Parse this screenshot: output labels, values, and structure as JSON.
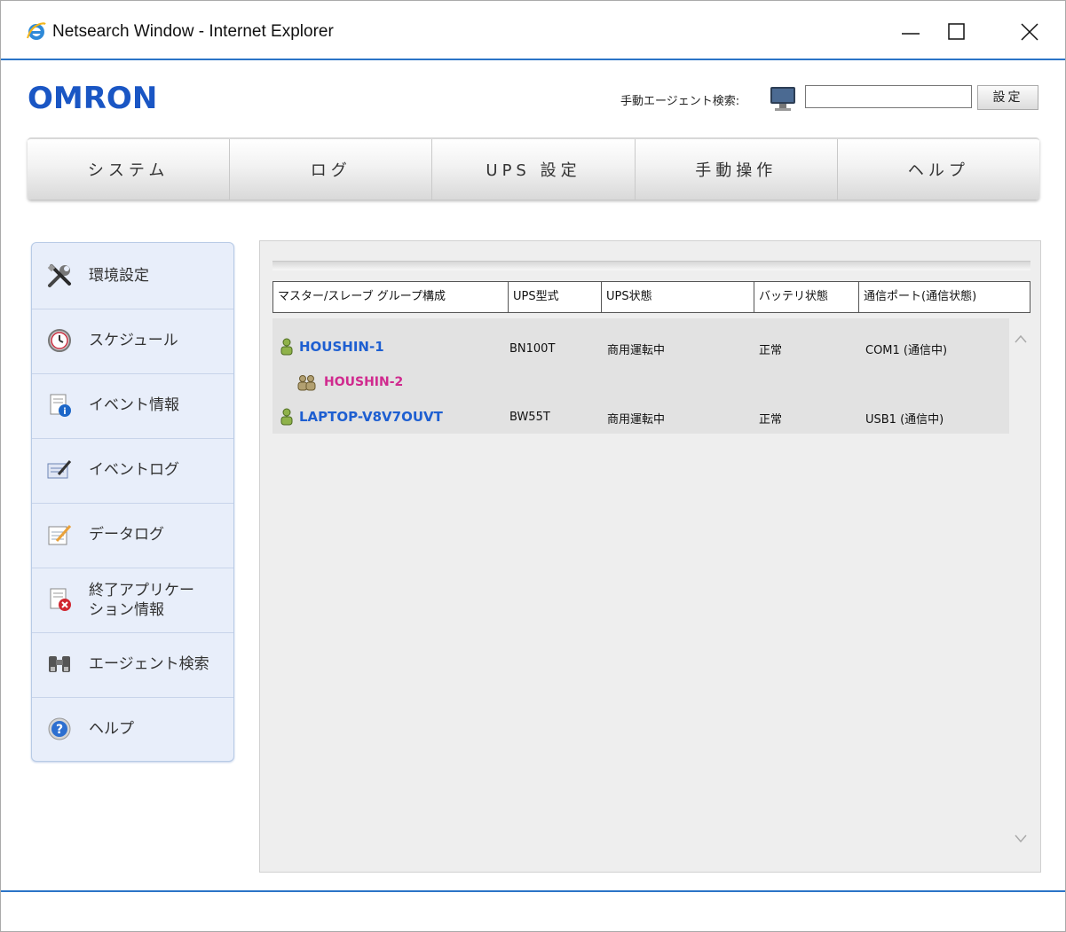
{
  "window": {
    "title": "Netsearch Window - Internet Explorer",
    "minimize_icon": "minimize-icon",
    "maximize_icon": "maximize-icon",
    "close_icon": "close-icon",
    "accent_color": "#2b74c7"
  },
  "header": {
    "logo": "OMRON",
    "logo_color": "#1a56c4",
    "search_label": "手動エージェント検索:",
    "search_value": "",
    "set_button": "設定"
  },
  "nav": {
    "items": [
      {
        "label": "システム"
      },
      {
        "label": "ログ"
      },
      {
        "label": "UPS 設定"
      },
      {
        "label": "手動操作"
      },
      {
        "label": "ヘルプ"
      }
    ]
  },
  "sidebar": {
    "items": [
      {
        "label": "環境設定",
        "icon": "tools-icon"
      },
      {
        "label": "スケジュール",
        "icon": "clock-icon"
      },
      {
        "label": "イベント情報",
        "icon": "info-document-icon"
      },
      {
        "label": "イベントログ",
        "icon": "edit-log-icon"
      },
      {
        "label": "データログ",
        "icon": "notepad-icon"
      },
      {
        "label": "終了アプリケー",
        "label2": "ション情報",
        "icon": "document-error-icon"
      },
      {
        "label": "エージェント検索",
        "icon": "binoculars-icon"
      },
      {
        "label": "ヘルプ",
        "icon": "help-icon"
      }
    ]
  },
  "table": {
    "columns": [
      "マスター/スレーブ グループ構成",
      "UPS型式",
      "UPS状態",
      "バッテリ状態",
      "通信ポート(通信状態)"
    ],
    "rows": [
      {
        "name": "HOUSHIN-1",
        "model": "BN100T",
        "ups_status": "商用運転中",
        "battery": "正常",
        "port": "COM1 (通信中)",
        "type": "master"
      },
      {
        "name": "HOUSHIN-2",
        "type": "slave"
      },
      {
        "name": "LAPTOP-V8V7OUVT",
        "model": "BW55T",
        "ups_status": "商用運転中",
        "battery": "正常",
        "port": "USB1 (通信中)",
        "type": "master"
      }
    ]
  }
}
